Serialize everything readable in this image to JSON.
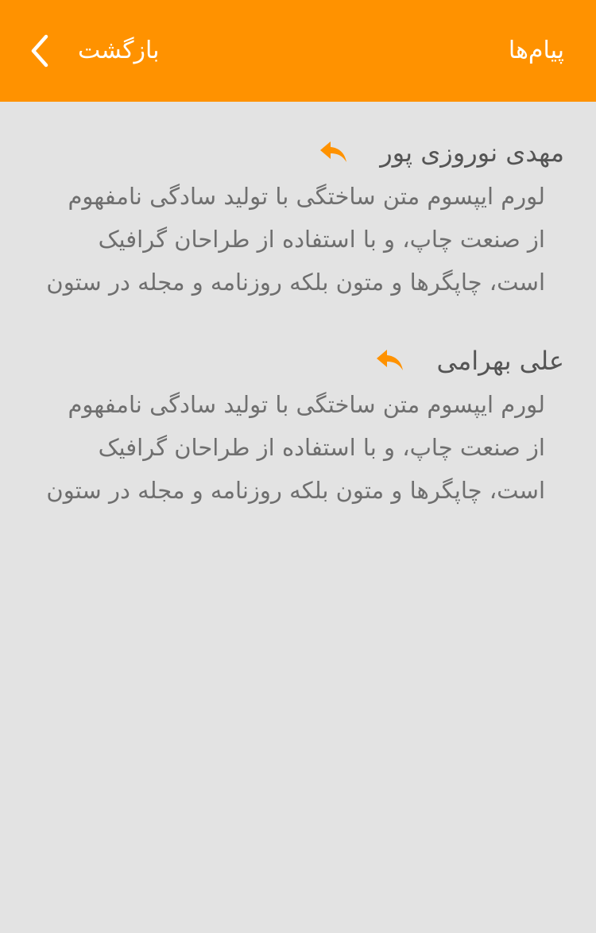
{
  "header": {
    "title": "پیام‌ها",
    "back_label": "بازگشت"
  },
  "messages": [
    {
      "sender": "مهدی نوروزی پور",
      "lines": [
        "لورم ایپسوم متن ساختگی با تولید سادگی نامفهوم",
        "از صنعت چاپ، و با استفاده از طراحان گرافیک",
        "است، چاپگرها و متون بلکه روزنامه و مجله در ستون"
      ]
    },
    {
      "sender": "علی بهرامی",
      "lines": [
        "لورم ایپسوم متن ساختگی با تولید سادگی نامفهوم",
        "از صنعت چاپ، و با استفاده از طراحان گرافیک",
        "است، چاپگرها و متون بلکه روزنامه و مجله در ستون"
      ]
    }
  ],
  "icons": {
    "back": "chevron-left-icon",
    "reply": "reply-icon"
  },
  "colors": {
    "accent": "#ff9200",
    "background": "#e3e3e3",
    "header_text": "#ffffff",
    "name_text": "#555555",
    "body_text": "#6f6f6f"
  }
}
